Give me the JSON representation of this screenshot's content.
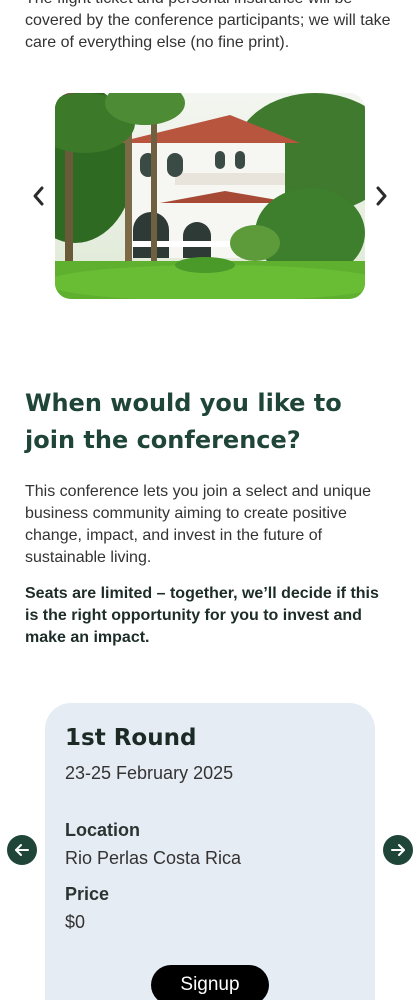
{
  "intro": {
    "text": "The flight ticket and personal insurance will be covered by the conference participants; we will take care of everything else (no fine print)."
  },
  "gallery": {
    "prev_icon": "chevron-left-icon",
    "next_icon": "chevron-right-icon",
    "photo": "white colonial villa with palm trees and green lawn"
  },
  "join_section": {
    "heading": "When would you like to join the conference?",
    "description": "This conference lets you join a select and unique business community aiming to create positive change, impact, and invest in the future of sustainable living.",
    "highlight": "Seats are limited – together, we’ll decide if this is the right opportunity for you to invest and make an impact."
  },
  "round_card": {
    "title": "1st Round",
    "dates": "23-25 February 2025",
    "location_label": "Location",
    "location_value": "Rio Perlas Costa Rica",
    "price_label": "Price",
    "price_value": "$0",
    "signup_label": "Signup"
  },
  "round_nav": {
    "prev_icon": "arrow-left-icon",
    "next_icon": "arrow-right-icon"
  },
  "colors": {
    "heading": "#1f4538",
    "card_bg": "#e6ecf4",
    "button_bg": "#000000",
    "nav_circle": "#1f4538"
  }
}
